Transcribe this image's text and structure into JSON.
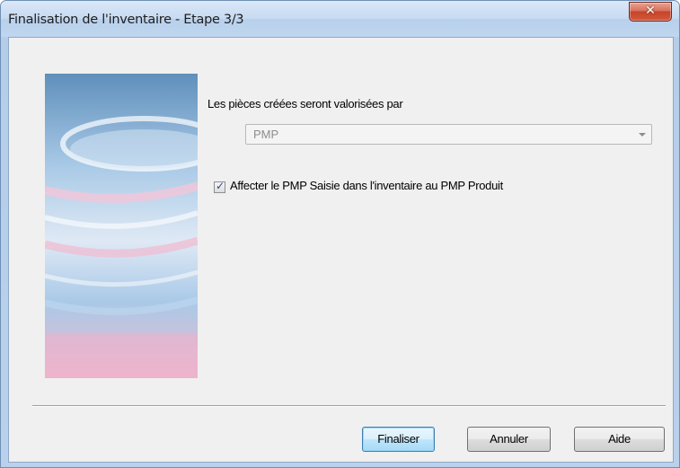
{
  "window": {
    "title": "Finalisation de l'inventaire - Etape 3/3",
    "close_icon": "✕"
  },
  "form": {
    "valuation_label": "Les pièces créées seront valorisées par",
    "valuation_value": "PMP",
    "checkbox_label": "Affecter le PMP Saisie dans l'inventaire au PMP Produit",
    "checkbox_checked": true
  },
  "buttons": {
    "finalize": "Finaliser",
    "cancel": "Annuler",
    "help": "Aide"
  },
  "colors": {
    "frame": "#b9d1ec",
    "client": "#f0f0f0",
    "close": "#c5452a",
    "default_button": "#3c7fb1"
  },
  "icons": {
    "close": "close-icon",
    "dropdown": "chevron-down-icon",
    "check": "check-icon"
  }
}
